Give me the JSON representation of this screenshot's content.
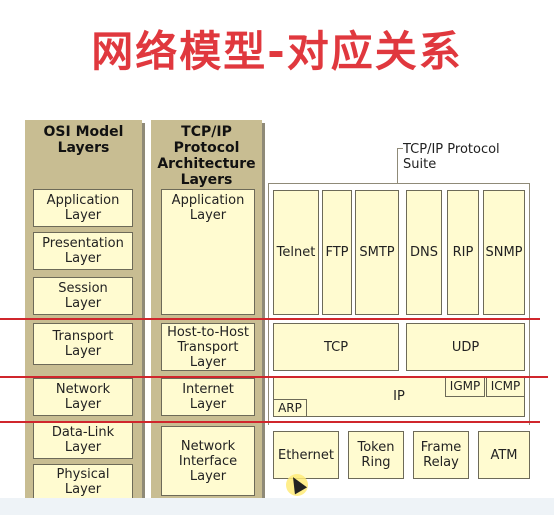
{
  "title": "网络模型-对应关系",
  "osi": {
    "header": "OSI Model\nLayers",
    "layers": [
      "Application\nLayer",
      "Presentation\nLayer",
      "Session\nLayer",
      "Transport\nLayer",
      "Network\nLayer",
      "Data-Link\nLayer",
      "Physical\nLayer"
    ]
  },
  "tcpip": {
    "header": "TCP/IP\nProtocol\nArchitecture\nLayers",
    "layers": [
      "Application\nLayer",
      "Host-to-Host\nTransport\nLayer",
      "Internet\nLayer",
      "Network\nInterface\nLayer"
    ]
  },
  "suite": {
    "label": "TCP/IP Protocol\nSuite",
    "app_protocols": [
      "Telnet",
      "FTP",
      "SMTP",
      "DNS",
      "RIP",
      "SNMP"
    ],
    "transport": [
      "TCP",
      "UDP"
    ],
    "internet": {
      "ip": "IP",
      "igmp": "IGMP",
      "icmp": "ICMP",
      "arp": "ARP"
    },
    "link": [
      "Ethernet",
      "Token\nRing",
      "Frame\nRelay",
      "ATM"
    ]
  },
  "colors": {
    "title": "#e0383e",
    "redline": "#d0262c",
    "column": "#c8bd92",
    "box": "#fffbd0"
  }
}
